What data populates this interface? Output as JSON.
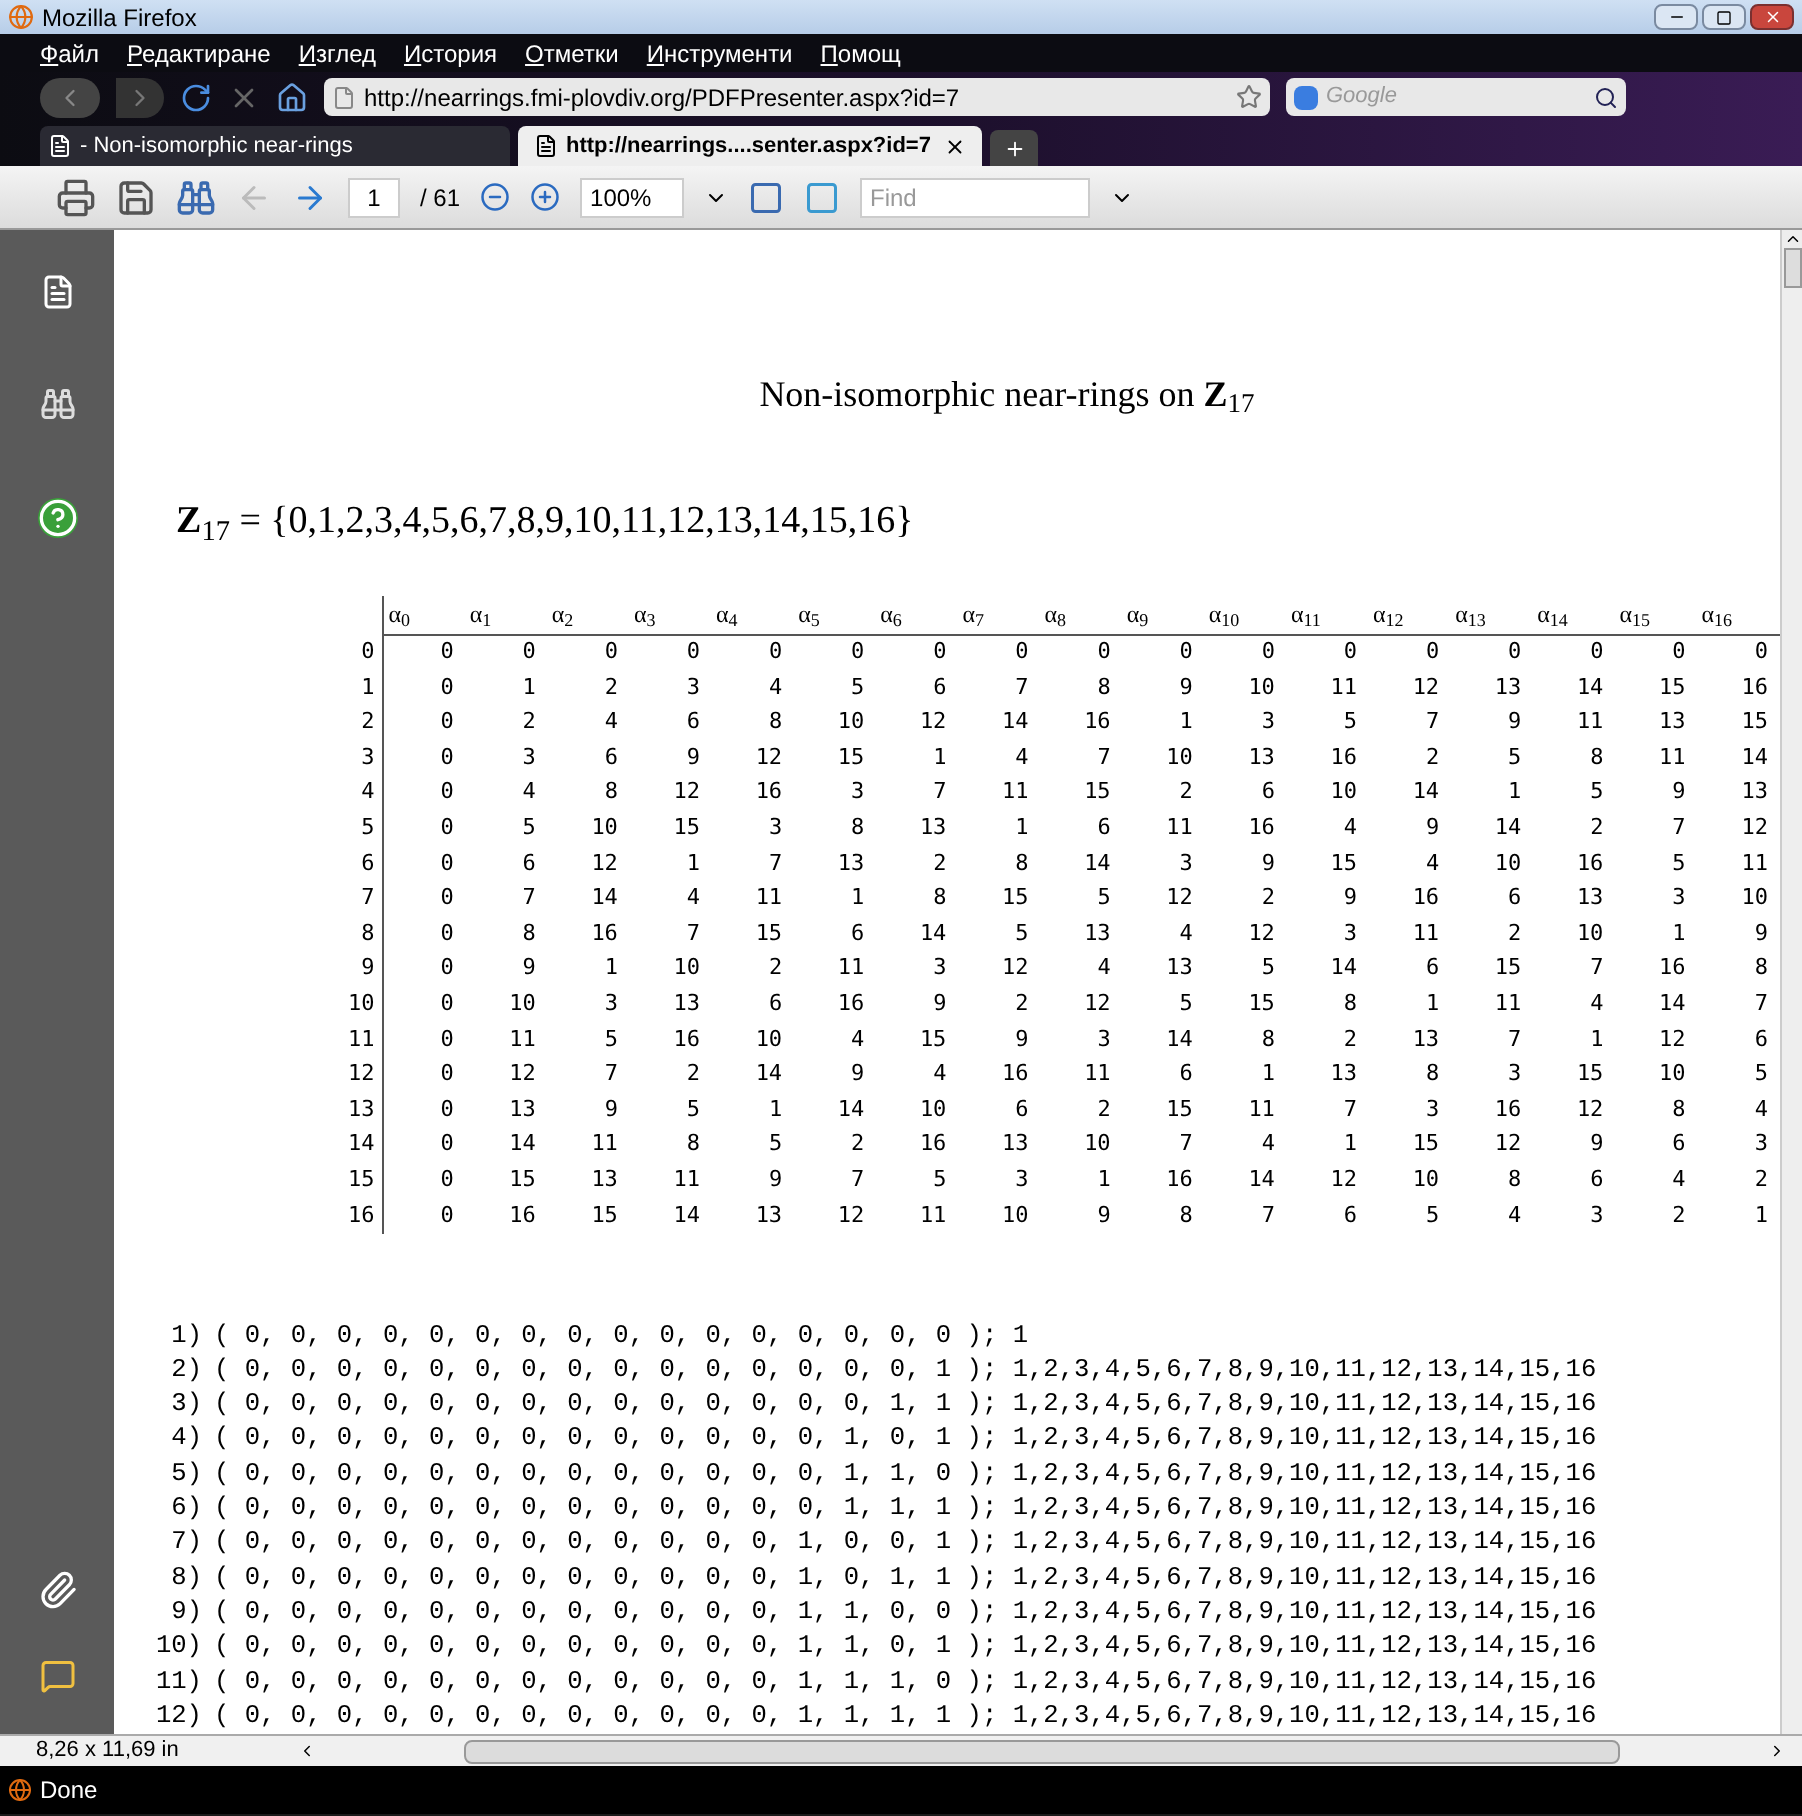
{
  "window": {
    "title": "Mozilla Firefox"
  },
  "menu": [
    "Файл",
    "Редактиране",
    "Изглед",
    "История",
    "Отметки",
    "Инструменти",
    "Помощ"
  ],
  "nav": {
    "url": "http://nearrings.fmi-plovdiv.org/PDFPresenter.aspx?id=7",
    "search_placeholder": "Google"
  },
  "tabs": [
    {
      "label": "- Non-isomorphic near-rings",
      "selected": false
    },
    {
      "label": "http://nearrings....senter.aspx?id=7",
      "selected": true
    }
  ],
  "pdf_toolbar": {
    "page": "1",
    "pages": "/ 61",
    "zoom": "100%",
    "find_placeholder": "Find"
  },
  "document": {
    "title": "Non-isomorphic near-rings on **Z**$_{17}$",
    "set_line": "**Z**$_{17}$ = {0,1,2,3,4,5,6,7,8,9,10,11,12,13,14,15,16}",
    "table": {
      "columns": [
        "α$_{0}$",
        "α$_{1}$",
        "α$_{2}$",
        "α$_{3}$",
        "α$_{4}$",
        "α$_{5}$",
        "α$_{6}$",
        "α$_{7}$",
        "α$_{8}$",
        "α$_{9}$",
        "α$_{10}$",
        "α$_{11}$",
        "α$_{12}$",
        "α$_{13}$",
        "α$_{14}$",
        "α$_{15}$",
        "α$_{16}$"
      ],
      "rows": [
        {
          "label": "0",
          "cells": [
            "0",
            "0",
            "0",
            "0",
            "0",
            "0",
            "0",
            "0",
            "0",
            "0",
            "0",
            "0",
            "0",
            "0",
            "0",
            "0",
            "0"
          ]
        },
        {
          "label": "1",
          "cells": [
            "0",
            "1",
            "2",
            "3",
            "4",
            "5",
            "6",
            "7",
            "8",
            "9",
            "10",
            "11",
            "12",
            "13",
            "14",
            "15",
            "16"
          ]
        },
        {
          "label": "2",
          "cells": [
            "0",
            "2",
            "4",
            "6",
            "8",
            "10",
            "12",
            "14",
            "16",
            "1",
            "3",
            "5",
            "7",
            "9",
            "11",
            "13",
            "15"
          ]
        },
        {
          "label": "3",
          "cells": [
            "0",
            "3",
            "6",
            "9",
            "12",
            "15",
            "1",
            "4",
            "7",
            "10",
            "13",
            "16",
            "2",
            "5",
            "8",
            "11",
            "14"
          ]
        },
        {
          "label": "4",
          "cells": [
            "0",
            "4",
            "8",
            "12",
            "16",
            "3",
            "7",
            "11",
            "15",
            "2",
            "6",
            "10",
            "14",
            "1",
            "5",
            "9",
            "13"
          ]
        },
        {
          "label": "5",
          "cells": [
            "0",
            "5",
            "10",
            "15",
            "3",
            "8",
            "13",
            "1",
            "6",
            "11",
            "16",
            "4",
            "9",
            "14",
            "2",
            "7",
            "12"
          ]
        },
        {
          "label": "6",
          "cells": [
            "0",
            "6",
            "12",
            "1",
            "7",
            "13",
            "2",
            "8",
            "14",
            "3",
            "9",
            "15",
            "4",
            "10",
            "16",
            "5",
            "11"
          ]
        },
        {
          "label": "7",
          "cells": [
            "0",
            "7",
            "14",
            "4",
            "11",
            "1",
            "8",
            "15",
            "5",
            "12",
            "2",
            "9",
            "16",
            "6",
            "13",
            "3",
            "10"
          ]
        },
        {
          "label": "8",
          "cells": [
            "0",
            "8",
            "16",
            "7",
            "15",
            "6",
            "14",
            "5",
            "13",
            "4",
            "12",
            "3",
            "11",
            "2",
            "10",
            "1",
            "9"
          ]
        },
        {
          "label": "9",
          "cells": [
            "0",
            "9",
            "1",
            "10",
            "2",
            "11",
            "3",
            "12",
            "4",
            "13",
            "5",
            "14",
            "6",
            "15",
            "7",
            "16",
            "8"
          ]
        },
        {
          "label": "10",
          "cells": [
            "0",
            "10",
            "3",
            "13",
            "6",
            "16",
            "9",
            "2",
            "12",
            "5",
            "15",
            "8",
            "1",
            "11",
            "4",
            "14",
            "7"
          ]
        },
        {
          "label": "11",
          "cells": [
            "0",
            "11",
            "5",
            "16",
            "10",
            "4",
            "15",
            "9",
            "3",
            "14",
            "8",
            "2",
            "13",
            "7",
            "1",
            "12",
            "6"
          ]
        },
        {
          "label": "12",
          "cells": [
            "0",
            "12",
            "7",
            "2",
            "14",
            "9",
            "4",
            "16",
            "11",
            "6",
            "1",
            "13",
            "8",
            "3",
            "15",
            "10",
            "5"
          ]
        },
        {
          "label": "13",
          "cells": [
            "0",
            "13",
            "9",
            "5",
            "1",
            "14",
            "10",
            "6",
            "2",
            "15",
            "11",
            "7",
            "3",
            "16",
            "12",
            "8",
            "4"
          ]
        },
        {
          "label": "14",
          "cells": [
            "0",
            "14",
            "11",
            "8",
            "5",
            "2",
            "16",
            "13",
            "10",
            "7",
            "4",
            "1",
            "15",
            "12",
            "9",
            "6",
            "3"
          ]
        },
        {
          "label": "15",
          "cells": [
            "0",
            "15",
            "13",
            "11",
            "9",
            "7",
            "5",
            "3",
            "1",
            "16",
            "14",
            "12",
            "10",
            "8",
            "6",
            "4",
            "2"
          ]
        },
        {
          "label": "16",
          "cells": [
            "0",
            "16",
            "15",
            "14",
            "13",
            "12",
            "11",
            "10",
            "9",
            "8",
            "7",
            "6",
            "5",
            "4",
            "3",
            "2",
            "1"
          ]
        }
      ]
    },
    "listing": [
      {
        "no": "1)",
        "text": "( 0, 0, 0, 0, 0, 0, 0, 0, 0, 0, 0, 0, 0, 0, 0, 0 ); 1"
      },
      {
        "no": "2)",
        "text": "( 0, 0, 0, 0, 0, 0, 0, 0, 0, 0, 0, 0, 0, 0, 0, 1 ); 1,2,3,4,5,6,7,8,9,10,11,12,13,14,15,16"
      },
      {
        "no": "3)",
        "text": "( 0, 0, 0, 0, 0, 0, 0, 0, 0, 0, 0, 0, 0, 0, 1, 1 ); 1,2,3,4,5,6,7,8,9,10,11,12,13,14,15,16"
      },
      {
        "no": "4)",
        "text": "( 0, 0, 0, 0, 0, 0, 0, 0, 0, 0, 0, 0, 0, 1, 0, 1 ); 1,2,3,4,5,6,7,8,9,10,11,12,13,14,15,16"
      },
      {
        "no": "5)",
        "text": "( 0, 0, 0, 0, 0, 0, 0, 0, 0, 0, 0, 0, 0, 1, 1, 0 ); 1,2,3,4,5,6,7,8,9,10,11,12,13,14,15,16"
      },
      {
        "no": "6)",
        "text": "( 0, 0, 0, 0, 0, 0, 0, 0, 0, 0, 0, 0, 0, 1, 1, 1 ); 1,2,3,4,5,6,7,8,9,10,11,12,13,14,15,16"
      },
      {
        "no": "7)",
        "text": "( 0, 0, 0, 0, 0, 0, 0, 0, 0, 0, 0, 0, 1, 0, 0, 1 ); 1,2,3,4,5,6,7,8,9,10,11,12,13,14,15,16"
      },
      {
        "no": "8)",
        "text": "( 0, 0, 0, 0, 0, 0, 0, 0, 0, 0, 0, 0, 1, 0, 1, 1 ); 1,2,3,4,5,6,7,8,9,10,11,12,13,14,15,16"
      },
      {
        "no": "9)",
        "text": "( 0, 0, 0, 0, 0, 0, 0, 0, 0, 0, 0, 0, 1, 1, 0, 0 ); 1,2,3,4,5,6,7,8,9,10,11,12,13,14,15,16"
      },
      {
        "no": "10)",
        "text": "( 0, 0, 0, 0, 0, 0, 0, 0, 0, 0, 0, 0, 1, 1, 0, 1 ); 1,2,3,4,5,6,7,8,9,10,11,12,13,14,15,16"
      },
      {
        "no": "11)",
        "text": "( 0, 0, 0, 0, 0, 0, 0, 0, 0, 0, 0, 0, 1, 1, 1, 0 ); 1,2,3,4,5,6,7,8,9,10,11,12,13,14,15,16"
      },
      {
        "no": "12)",
        "text": "( 0, 0, 0, 0, 0, 0, 0, 0, 0, 0, 0, 0, 1, 1, 1, 1 ); 1,2,3,4,5,6,7,8,9,10,11,12,13,14,15,16"
      }
    ]
  },
  "page_size": "8,26 x 11,69 in",
  "status": "Done"
}
